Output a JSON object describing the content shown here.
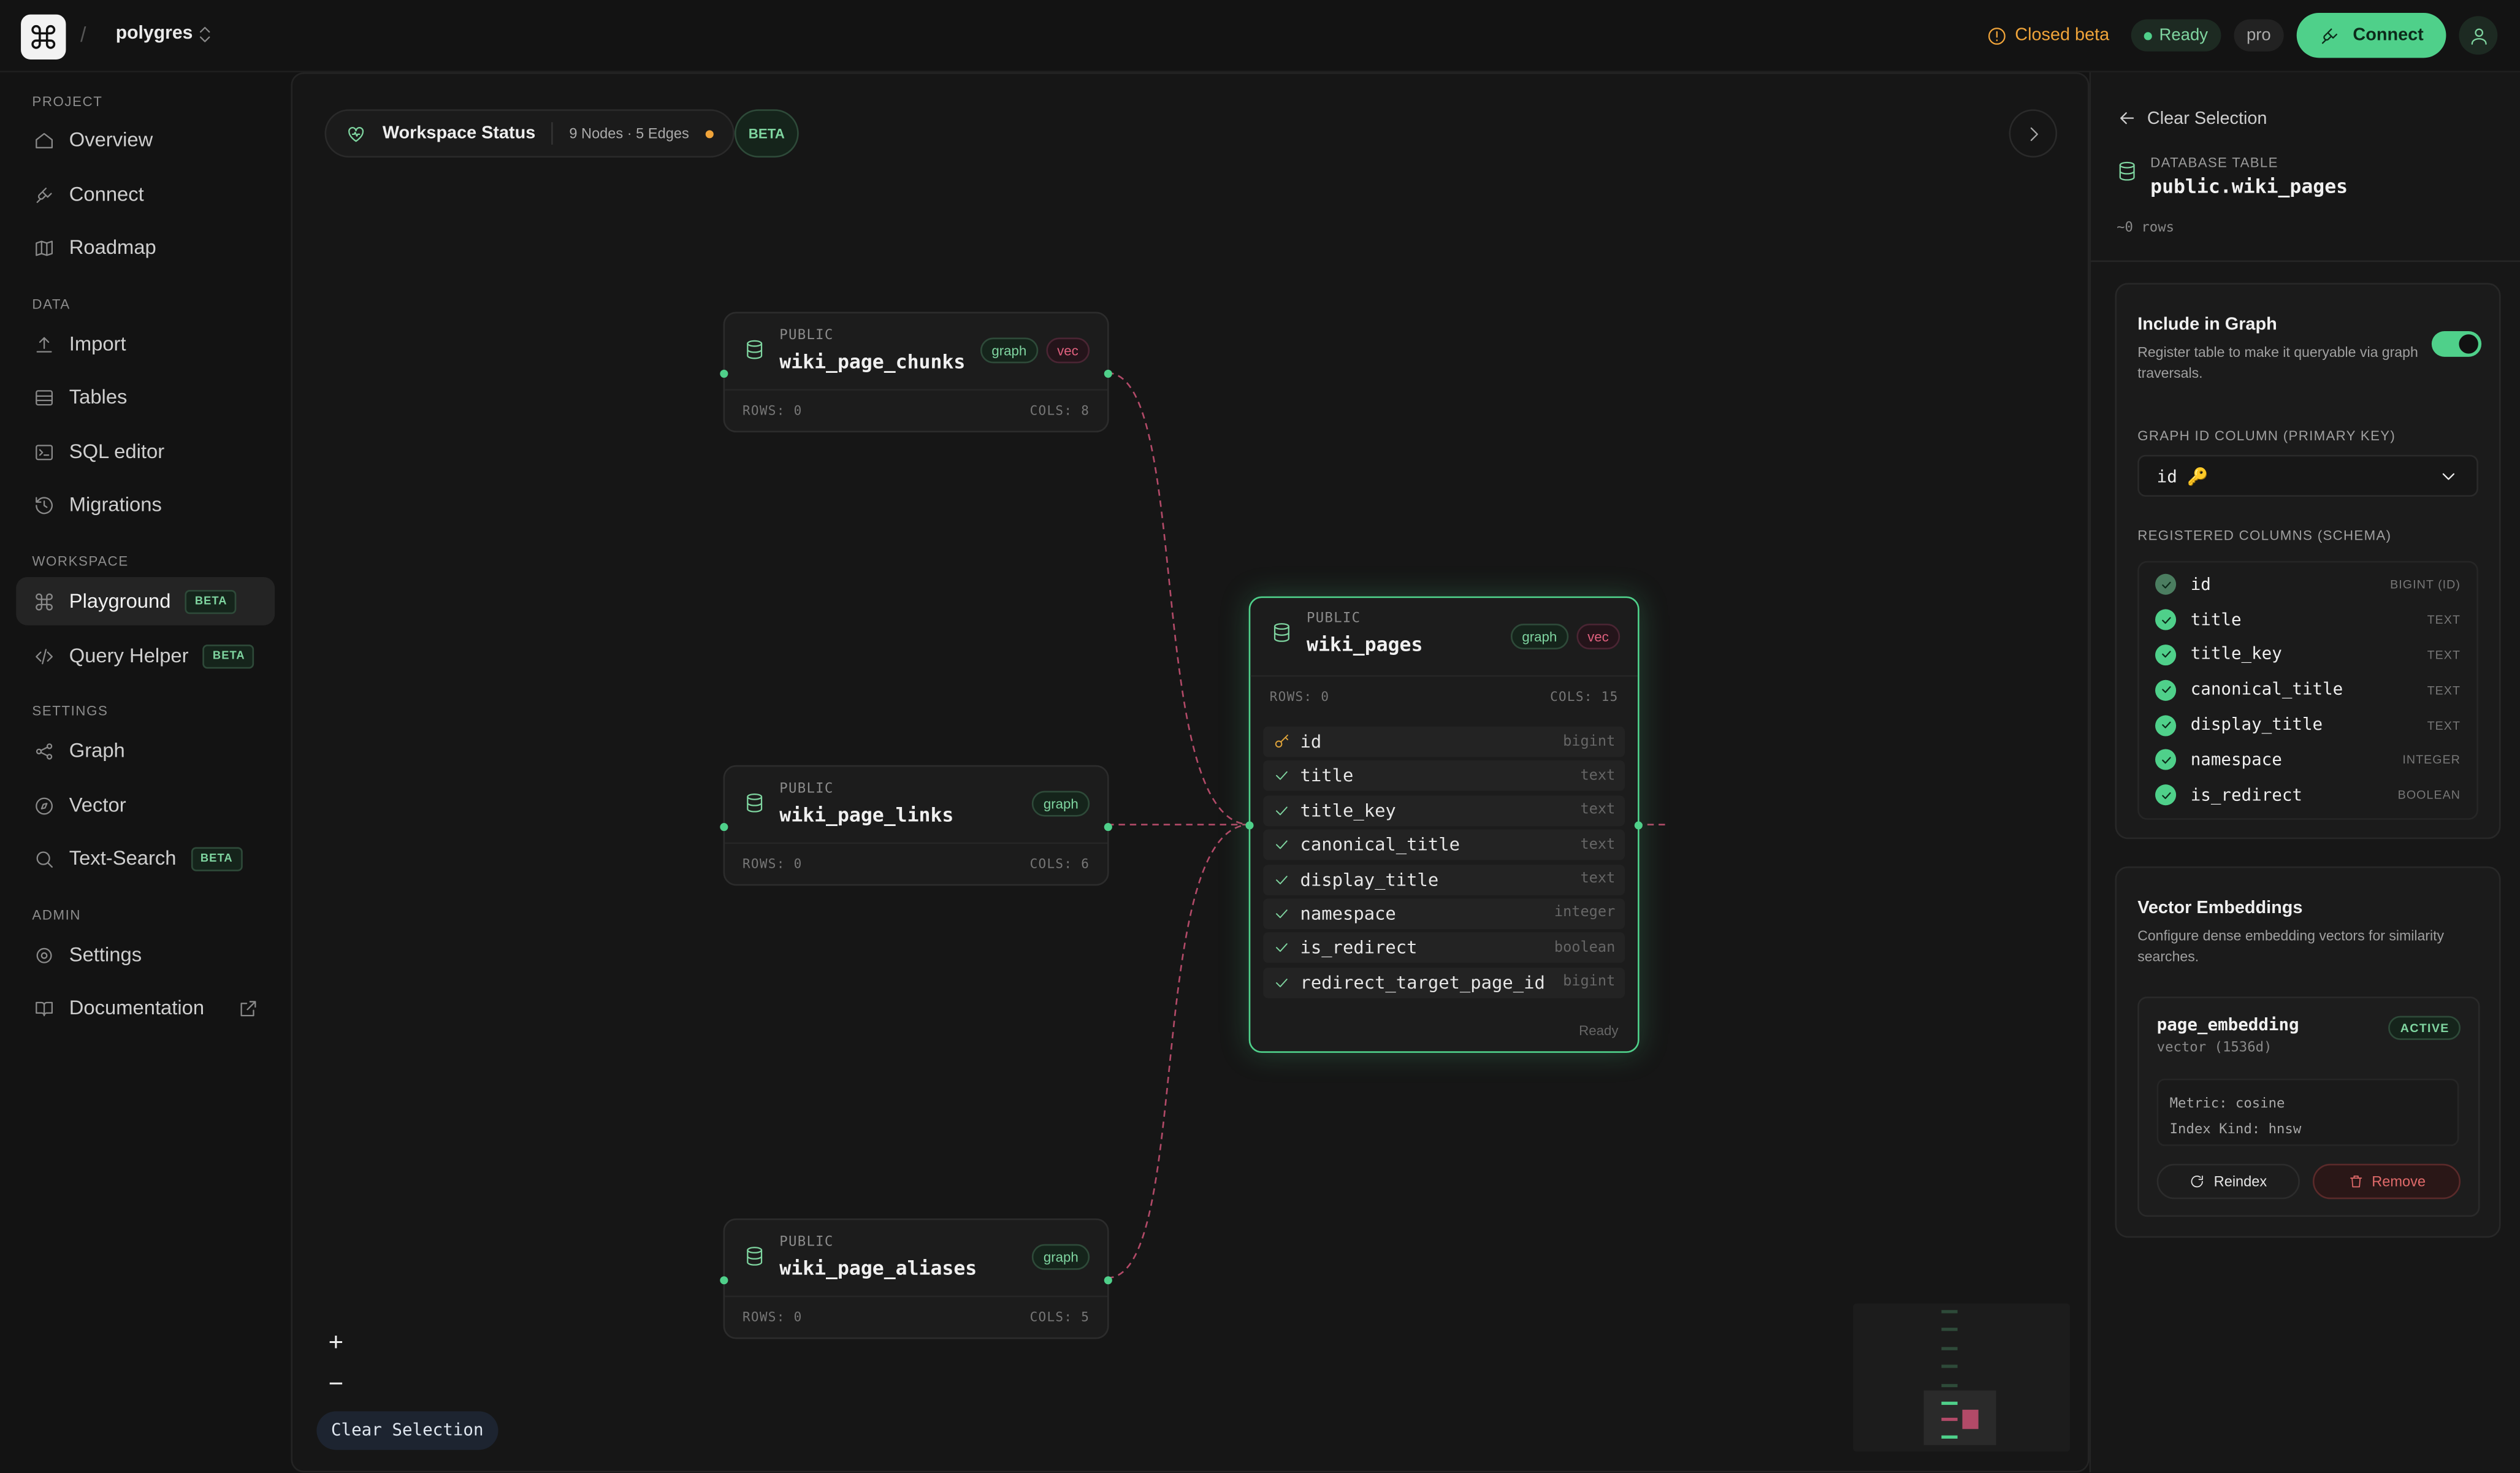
{
  "header": {
    "slash": "/",
    "project_name": "polygres",
    "closed_beta": "Closed beta",
    "status": "Ready",
    "plan": "pro",
    "connect_label": "Connect"
  },
  "sidebar": {
    "sections": {
      "project": "PROJECT",
      "data": "DATA",
      "workspace": "WORKSPACE",
      "settings": "SETTINGS",
      "admin": "ADMIN"
    },
    "items": {
      "overview": "Overview",
      "connect": "Connect",
      "roadmap": "Roadmap",
      "import": "Import",
      "tables": "Tables",
      "sql_editor": "SQL editor",
      "migrations": "Migrations",
      "playground": "Playground",
      "query_helper": "Query Helper",
      "graph": "Graph",
      "vector": "Vector",
      "text_search": "Text-Search",
      "settings": "Settings",
      "documentation": "Documentation"
    },
    "beta_label": "BETA",
    "active_item": "Playground"
  },
  "canvas": {
    "workspace_status": "Workspace Status",
    "counts": "9 Nodes · 5 Edges",
    "beta": "BETA",
    "clear_selection": "Clear Selection",
    "zoom_in": "+",
    "zoom_out": "−",
    "nodes": {
      "chunks": {
        "schema": "PUBLIC",
        "name": "wiki_page_chunks",
        "tag1": "graph",
        "tag2": "vec",
        "rows": "ROWS: 0",
        "cols": "COLS: 8"
      },
      "links": {
        "schema": "PUBLIC",
        "name": "wiki_page_links",
        "tag1": "graph",
        "rows": "ROWS: 0",
        "cols": "COLS: 6"
      },
      "aliases": {
        "schema": "PUBLIC",
        "name": "wiki_page_aliases",
        "tag1": "graph",
        "rows": "ROWS: 0",
        "cols": "COLS: 5"
      },
      "pages": {
        "schema": "PUBLIC",
        "name": "wiki_pages",
        "tag1": "graph",
        "tag2": "vec",
        "rows": "ROWS: 0",
        "cols": "COLS: 15",
        "status": "Ready",
        "columns": [
          {
            "name": "id",
            "type": "bigint"
          },
          {
            "name": "title",
            "type": "text"
          },
          {
            "name": "title_key",
            "type": "text"
          },
          {
            "name": "canonical_title",
            "type": "text"
          },
          {
            "name": "display_title",
            "type": "text"
          },
          {
            "name": "namespace",
            "type": "integer"
          },
          {
            "name": "is_redirect",
            "type": "boolean"
          },
          {
            "name": "redirect_target_page_id",
            "type": "bigint"
          }
        ]
      }
    }
  },
  "panel": {
    "clear_selection": "Clear Selection",
    "kind": "DATABASE TABLE",
    "table": "public.wiki_pages",
    "rows": "~0 rows",
    "include": {
      "title": "Include in Graph",
      "desc1": "Register table to make it queryable via graph",
      "desc2": "traversals.",
      "enabled": true,
      "id_label": "GRAPH ID COLUMN (PRIMARY KEY)",
      "id_value": "id 🔑",
      "cols_label": "REGISTERED COLUMNS (SCHEMA)",
      "columns": [
        {
          "name": "id",
          "type": "BIGINT (ID)"
        },
        {
          "name": "title",
          "type": "TEXT"
        },
        {
          "name": "title_key",
          "type": "TEXT"
        },
        {
          "name": "canonical_title",
          "type": "TEXT"
        },
        {
          "name": "display_title",
          "type": "TEXT"
        },
        {
          "name": "namespace",
          "type": "INTEGER"
        },
        {
          "name": "is_redirect",
          "type": "BOOLEAN"
        }
      ]
    },
    "vector": {
      "title": "Vector Embeddings",
      "desc1": "Configure dense embedding vectors for similarity",
      "desc2": "searches.",
      "embedding_name": "page_embedding",
      "embedding_sub": "vector (1536d)",
      "status": "ACTIVE",
      "metric": "Metric: cosine",
      "index": "Index Kind: hnsw",
      "reindex": "Reindex",
      "remove": "Remove"
    }
  },
  "colors": {
    "accent": "#4fd08a",
    "vec": "#e0607e",
    "warning": "#f0a43a",
    "background": "#131313"
  }
}
